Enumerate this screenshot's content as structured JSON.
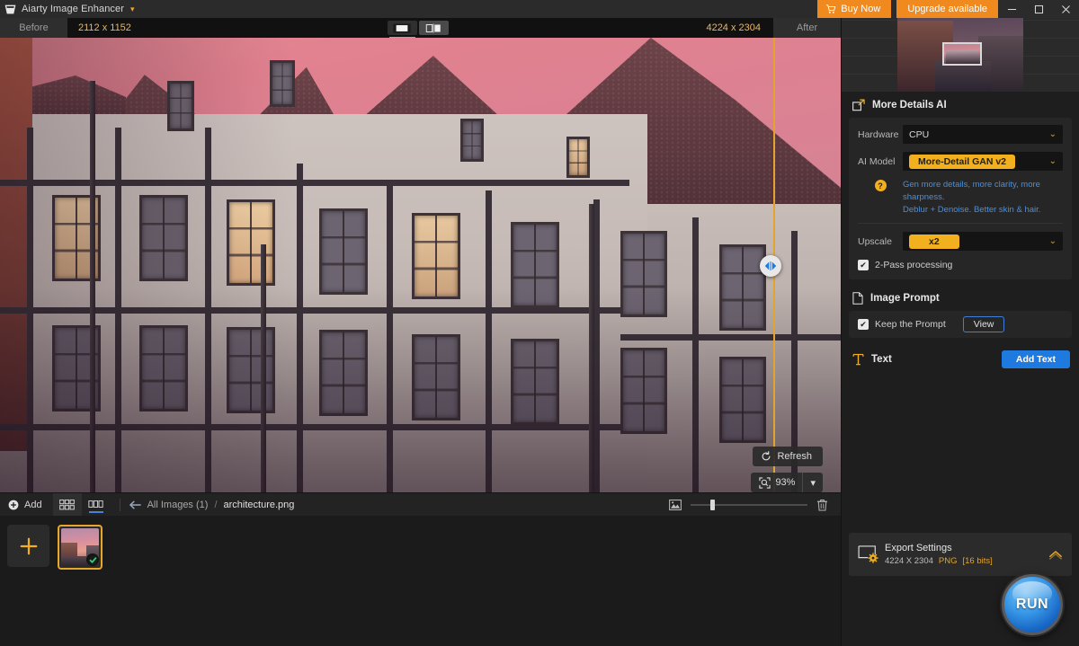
{
  "titlebar": {
    "app_name": "Aiarty Image Enhancer",
    "logo_icon": "app-logo-icon",
    "dropdown_caret": "▾",
    "buy_now": "Buy Now",
    "cart_icon": "cart-icon",
    "upgrade": "Upgrade available",
    "minimize": "—",
    "maximize": "▢",
    "close": "✕"
  },
  "subbar": {
    "before_label": "Before",
    "before_dimensions": "2112 x 1152",
    "after_label": "After",
    "after_dimensions": "4224 x 2304",
    "view_single_icon": "single-view-icon",
    "view_split_icon": "split-view-icon"
  },
  "canvas": {
    "compare_handle_icon": "compare-slider-handle-icon",
    "refresh_label": "Refresh",
    "refresh_icon": "refresh-icon",
    "zoom_icon": "zoom-fit-icon",
    "zoom_level": "93%",
    "zoom_caret": "▾"
  },
  "bottombar": {
    "add_label": "Add",
    "add_icon": "plus-circle-icon",
    "grid_view_icon": "grid-view-icon",
    "list_view_icon": "filmstrip-view-icon",
    "back_icon": "back-arrow-icon",
    "breadcrumb_root": "All Images (1)",
    "breadcrumb_sep": "/",
    "breadcrumb_current": "architecture.png",
    "thumb_size_icon": "thumbnail-size-icon",
    "delete_icon": "trash-icon"
  },
  "filmstrip": {
    "add_tile_icon": "plus-icon",
    "selected_check_icon": "check-circle-icon"
  },
  "right_panel": {
    "preview_icon": "preview-thumbnail",
    "more_details": {
      "title": "More Details AI",
      "icon": "expand-arrow-icon",
      "hardware_label": "Hardware",
      "hardware_value": "CPU",
      "ai_model_label": "AI Model",
      "ai_model_value": "More-Detail GAN v2",
      "help_icon": "?",
      "model_desc_line1": "Gen more details, more clarity, more sharpness.",
      "model_desc_line2": "Deblur + Denoise. Better skin & hair.",
      "upscale_label": "Upscale",
      "upscale_value": "x2",
      "two_pass_label": "2-Pass processing",
      "two_pass_checked": true,
      "chevron": "⌄"
    },
    "image_prompt": {
      "title": "Image Prompt",
      "icon": "document-icon",
      "keep_prompt_label": "Keep the Prompt",
      "keep_prompt_checked": true,
      "view_button": "View"
    },
    "text_section": {
      "title": "Text",
      "icon": "text-tool-icon",
      "add_text_button": "Add Text"
    },
    "export": {
      "title": "Export Settings",
      "icon": "export-settings-icon",
      "dimensions": "4224 X 2304",
      "format": "PNG",
      "bitdepth": "[16 bits]",
      "collapse_icon": "chevron-up-icon"
    },
    "run_button": "RUN"
  },
  "colors": {
    "accent_orange": "#f2b01e",
    "brand_orange": "#f08a1e",
    "link_blue": "#4d8fd8",
    "button_blue": "#1f7ae0",
    "panel_bg": "#1e1e1e",
    "section_bg": "#262626"
  }
}
